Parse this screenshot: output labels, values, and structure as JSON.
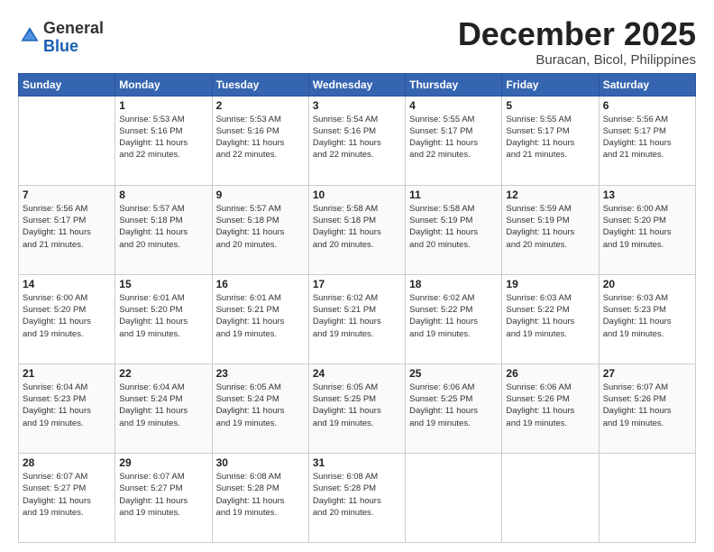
{
  "logo": {
    "general": "General",
    "blue": "Blue"
  },
  "header": {
    "title": "December 2025",
    "subtitle": "Buracan, Bicol, Philippines"
  },
  "days_of_week": [
    "Sunday",
    "Monday",
    "Tuesday",
    "Wednesday",
    "Thursday",
    "Friday",
    "Saturday"
  ],
  "weeks": [
    [
      {
        "day": "",
        "info": ""
      },
      {
        "day": "1",
        "info": "Sunrise: 5:53 AM\nSunset: 5:16 PM\nDaylight: 11 hours\nand 22 minutes."
      },
      {
        "day": "2",
        "info": "Sunrise: 5:53 AM\nSunset: 5:16 PM\nDaylight: 11 hours\nand 22 minutes."
      },
      {
        "day": "3",
        "info": "Sunrise: 5:54 AM\nSunset: 5:16 PM\nDaylight: 11 hours\nand 22 minutes."
      },
      {
        "day": "4",
        "info": "Sunrise: 5:55 AM\nSunset: 5:17 PM\nDaylight: 11 hours\nand 22 minutes."
      },
      {
        "day": "5",
        "info": "Sunrise: 5:55 AM\nSunset: 5:17 PM\nDaylight: 11 hours\nand 21 minutes."
      },
      {
        "day": "6",
        "info": "Sunrise: 5:56 AM\nSunset: 5:17 PM\nDaylight: 11 hours\nand 21 minutes."
      }
    ],
    [
      {
        "day": "7",
        "info": "Sunrise: 5:56 AM\nSunset: 5:17 PM\nDaylight: 11 hours\nand 21 minutes."
      },
      {
        "day": "8",
        "info": "Sunrise: 5:57 AM\nSunset: 5:18 PM\nDaylight: 11 hours\nand 20 minutes."
      },
      {
        "day": "9",
        "info": "Sunrise: 5:57 AM\nSunset: 5:18 PM\nDaylight: 11 hours\nand 20 minutes."
      },
      {
        "day": "10",
        "info": "Sunrise: 5:58 AM\nSunset: 5:18 PM\nDaylight: 11 hours\nand 20 minutes."
      },
      {
        "day": "11",
        "info": "Sunrise: 5:58 AM\nSunset: 5:19 PM\nDaylight: 11 hours\nand 20 minutes."
      },
      {
        "day": "12",
        "info": "Sunrise: 5:59 AM\nSunset: 5:19 PM\nDaylight: 11 hours\nand 20 minutes."
      },
      {
        "day": "13",
        "info": "Sunrise: 6:00 AM\nSunset: 5:20 PM\nDaylight: 11 hours\nand 19 minutes."
      }
    ],
    [
      {
        "day": "14",
        "info": "Sunrise: 6:00 AM\nSunset: 5:20 PM\nDaylight: 11 hours\nand 19 minutes."
      },
      {
        "day": "15",
        "info": "Sunrise: 6:01 AM\nSunset: 5:20 PM\nDaylight: 11 hours\nand 19 minutes."
      },
      {
        "day": "16",
        "info": "Sunrise: 6:01 AM\nSunset: 5:21 PM\nDaylight: 11 hours\nand 19 minutes."
      },
      {
        "day": "17",
        "info": "Sunrise: 6:02 AM\nSunset: 5:21 PM\nDaylight: 11 hours\nand 19 minutes."
      },
      {
        "day": "18",
        "info": "Sunrise: 6:02 AM\nSunset: 5:22 PM\nDaylight: 11 hours\nand 19 minutes."
      },
      {
        "day": "19",
        "info": "Sunrise: 6:03 AM\nSunset: 5:22 PM\nDaylight: 11 hours\nand 19 minutes."
      },
      {
        "day": "20",
        "info": "Sunrise: 6:03 AM\nSunset: 5:23 PM\nDaylight: 11 hours\nand 19 minutes."
      }
    ],
    [
      {
        "day": "21",
        "info": "Sunrise: 6:04 AM\nSunset: 5:23 PM\nDaylight: 11 hours\nand 19 minutes."
      },
      {
        "day": "22",
        "info": "Sunrise: 6:04 AM\nSunset: 5:24 PM\nDaylight: 11 hours\nand 19 minutes."
      },
      {
        "day": "23",
        "info": "Sunrise: 6:05 AM\nSunset: 5:24 PM\nDaylight: 11 hours\nand 19 minutes."
      },
      {
        "day": "24",
        "info": "Sunrise: 6:05 AM\nSunset: 5:25 PM\nDaylight: 11 hours\nand 19 minutes."
      },
      {
        "day": "25",
        "info": "Sunrise: 6:06 AM\nSunset: 5:25 PM\nDaylight: 11 hours\nand 19 minutes."
      },
      {
        "day": "26",
        "info": "Sunrise: 6:06 AM\nSunset: 5:26 PM\nDaylight: 11 hours\nand 19 minutes."
      },
      {
        "day": "27",
        "info": "Sunrise: 6:07 AM\nSunset: 5:26 PM\nDaylight: 11 hours\nand 19 minutes."
      }
    ],
    [
      {
        "day": "28",
        "info": "Sunrise: 6:07 AM\nSunset: 5:27 PM\nDaylight: 11 hours\nand 19 minutes."
      },
      {
        "day": "29",
        "info": "Sunrise: 6:07 AM\nSunset: 5:27 PM\nDaylight: 11 hours\nand 19 minutes."
      },
      {
        "day": "30",
        "info": "Sunrise: 6:08 AM\nSunset: 5:28 PM\nDaylight: 11 hours\nand 19 minutes."
      },
      {
        "day": "31",
        "info": "Sunrise: 6:08 AM\nSunset: 5:28 PM\nDaylight: 11 hours\nand 20 minutes."
      },
      {
        "day": "",
        "info": ""
      },
      {
        "day": "",
        "info": ""
      },
      {
        "day": "",
        "info": ""
      }
    ]
  ]
}
